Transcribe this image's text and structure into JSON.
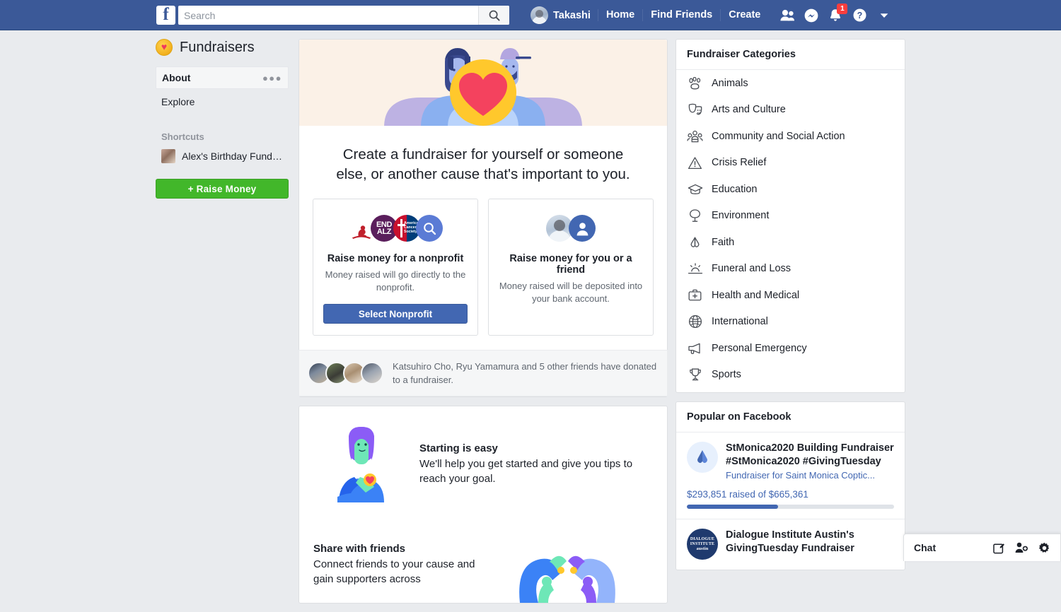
{
  "topbar": {
    "logo": "f",
    "search": {
      "placeholder": "Search",
      "value": "",
      "icon": "search-icon"
    },
    "user_name": "Takashi",
    "links": [
      "Home",
      "Find Friends",
      "Create"
    ],
    "icons": [
      "friend-requests-icon",
      "messenger-icon",
      "notifications-icon",
      "help-icon",
      "account-menu-caret-icon"
    ],
    "notification_count": "1"
  },
  "sidebar": {
    "title": "Fundraisers",
    "title_icon": "fundraiser-coin-heart-icon",
    "items": [
      {
        "label": "About",
        "active": true,
        "menu_icon": "ellipsis-icon"
      },
      {
        "label": "Explore",
        "active": false
      }
    ],
    "shortcuts_heading": "Shortcuts",
    "shortcuts": [
      {
        "label": "Alex's Birthday Fundrai..."
      }
    ],
    "raise_money_button": "+  Raise Money"
  },
  "main": {
    "hero_illustration": "two-people-holding-heart-illustration",
    "headline": "Create a fundraiser for yourself or someone else, or another cause that's important to you.",
    "choices": [
      {
        "title": "Raise money for a nonprofit",
        "subtitle": "Money raised will go directly to the nonprofit.",
        "button": "Select Nonprofit",
        "icons": [
          "charity-red-icon",
          "end-alz-logo",
          "american-cancer-society-logo",
          "search-more-icon"
        ],
        "alz_line1": "END",
        "alz_line2": "ALZ",
        "acs_text": "American Cancer Society®"
      },
      {
        "title": "Raise money for you or a friend",
        "subtitle": "Money raised will be deposited into your bank account.",
        "icons": [
          "user-photo-avatar",
          "person-silhouette-icon"
        ]
      }
    ],
    "friends_note": "Katsuhiro Cho, Ryu Yamamura and 5 other friends have donated to a fundraiser.",
    "promos": [
      {
        "title": "Starting is easy",
        "body": "We'll help you get started and give you tips to reach your goal.",
        "art": "woman-with-heart-illustration"
      },
      {
        "title": "Share with friends",
        "body": "Connect friends to your cause and gain supporters across",
        "art": "hands-forming-heart-illustration"
      }
    ]
  },
  "categories_card": {
    "heading": "Fundraiser Categories",
    "items": [
      {
        "label": "Animals",
        "icon": "paw-print-icon"
      },
      {
        "label": "Arts and Culture",
        "icon": "theater-masks-icon"
      },
      {
        "label": "Community and Social Action",
        "icon": "people-group-icon"
      },
      {
        "label": "Crisis Relief",
        "icon": "warning-triangle-icon"
      },
      {
        "label": "Education",
        "icon": "graduation-cap-icon"
      },
      {
        "label": "Environment",
        "icon": "tree-icon"
      },
      {
        "label": "Faith",
        "icon": "praying-hands-icon"
      },
      {
        "label": "Funeral and Loss",
        "icon": "sunset-icon"
      },
      {
        "label": "Health and Medical",
        "icon": "medical-kit-icon"
      },
      {
        "label": "International",
        "icon": "globe-icon"
      },
      {
        "label": "Personal Emergency",
        "icon": "megaphone-icon"
      },
      {
        "label": "Sports",
        "icon": "trophy-icon"
      }
    ]
  },
  "popular_card": {
    "heading": "Popular on Facebook",
    "items": [
      {
        "title": "StMonica2020 Building Fundraiser #StMonica2020 #GivingTuesday",
        "subtitle": "Fundraiser for Saint Monica Coptic...",
        "raised_text": "$293,851 raised of $665,361",
        "progress_percent": 44,
        "logo": "praying-hands-logo"
      },
      {
        "title": "Dialogue Institute Austin's GivingTuesday Fundraiser",
        "logo_line1": "DIALOGUE",
        "logo_line2": "INSTITUTE",
        "logo_line3": "austin",
        "logo": "dialogue-institute-austin-logo"
      }
    ]
  },
  "chatbar": {
    "label": "Chat",
    "icons": [
      "compose-message-icon",
      "new-group-icon",
      "chat-settings-gear-icon"
    ]
  },
  "colors": {
    "header_blue": "#3b5998",
    "accent_blue": "#4267b2",
    "green": "#42b72a",
    "page_bg": "#e9ebee",
    "hero_bg": "#fbf1e7",
    "heart_red": "#f0395d"
  }
}
